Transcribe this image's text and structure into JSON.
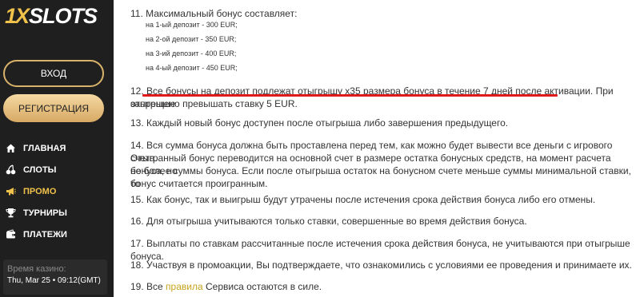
{
  "brand": {
    "logo_prefix": "1X",
    "logo_suffix": "SLOTS"
  },
  "auth": {
    "login_label": "ВХОД",
    "register_label": "РЕГИСТРАЦИЯ"
  },
  "nav": [
    {
      "label": "ГЛАВНАЯ",
      "icon": "home-icon"
    },
    {
      "label": "СЛОТЫ",
      "icon": "cherries-icon"
    },
    {
      "label": "ПРОМО",
      "icon": "megaphone-icon",
      "active": true
    },
    {
      "label": "ТУРНИРЫ",
      "icon": "trophy-icon"
    },
    {
      "label": "ПЛАТЕЖИ",
      "icon": "wallet-icon"
    }
  ],
  "casino_time": {
    "label": "Время казино:",
    "value": "Thu, Mar 25 • 09:12(GMT)"
  },
  "colors": {
    "accent": "#f0c24b",
    "sidebar_bg": "#1f1f1f",
    "link": "#c7a31b",
    "underline": "#e0191c"
  },
  "rules": {
    "r11_title": "11. Максимальный бонус составляет:",
    "r11_items": [
      "на 1-ый депозит - 300 EUR;",
      "на 2-ой депозит - 350 EUR;",
      "на 3-ий депозит - 400 EUR;",
      "на 4-ый депозит - 450 EUR;"
    ],
    "r12_line1": "12. Все бонусы на депозит подлежат отыгрышу х35 размера бонуса в течение 7 дней после активации. При отыгрыше",
    "r12_line2": "запрещено превышать ставку 5 EUR.",
    "r13": "13. Каждый новый бонус доступен после отыгрыша либо завершения предыдущего.",
    "r14_line1": "14. Вся сумма бонуса должна быть проставлена перед тем, как можно будет вывести все деньги с игрового счета.",
    "r14_line2": "Отыгранный бонус переводится на основной счет в размере остатка бонусных средств, на момент расчета бонуса, но",
    "r14_line3": "не более суммы бонуса. Если после отыгрыша остаток на бонусном счете меньше суммы минимальной ставки, то",
    "r14_line4": "бонус считается проигранным.",
    "r15": "15. Как бонус, так и выигрыш будут утрачены после истечения срока действия бонуса либо его отмены.",
    "r16": "16. Для отыгрыша учитываются только ставки, совершенные во время действия бонуса.",
    "r17": "17. Выплаты по ставкам рассчитанные после истечения срока действия бонуса, не учитываются при отыгрыше бонуса.",
    "r18": "18. Участвуя в промоакции, Вы подтверждаете, что ознакомились с условиями ее проведения и принимаете их.",
    "r19_prefix": "19. Все ",
    "r19_link": "правила",
    "r19_suffix": " Сервиса остаются в силе."
  }
}
